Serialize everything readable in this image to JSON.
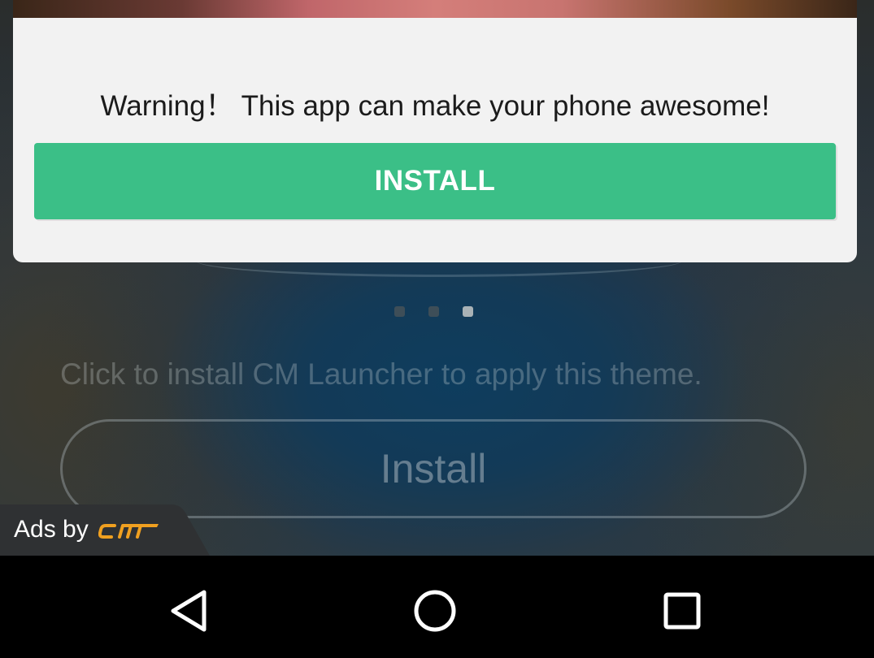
{
  "card": {
    "message": "Warning！ This app can make your phone awesome!",
    "install_label": "INSTALL"
  },
  "pager": {
    "count": 3,
    "active_index": 2
  },
  "background_screen": {
    "helper_text": "Click to install CM Launcher to apply this theme.",
    "install_label": "Install"
  },
  "ad_badge": {
    "label": "Ads by",
    "logo_icon": "cm-logo-icon"
  },
  "navigation_bar": {
    "buttons": [
      "back-icon",
      "home-icon",
      "recents-icon"
    ]
  },
  "colors": {
    "install_green": "#3bbf87",
    "card_bg": "#f2f2f2",
    "logo_orange": "#f0a020"
  }
}
